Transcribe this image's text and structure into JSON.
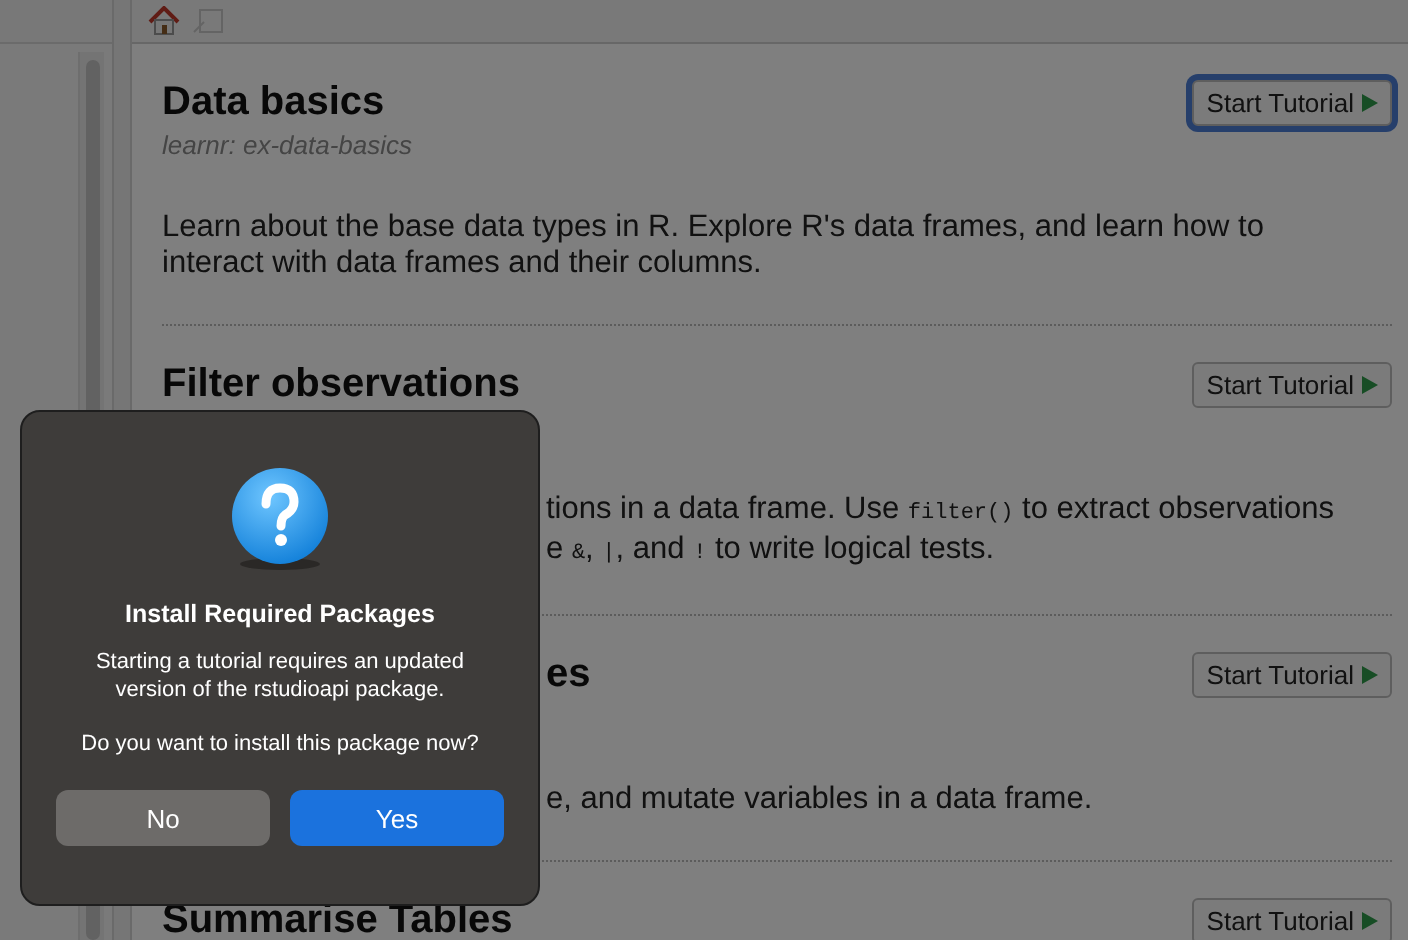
{
  "tutorials": [
    {
      "title": "Data basics",
      "title_clipped": false,
      "subtitle": "learnr: ex-data-basics",
      "description_clipped": false,
      "description": [
        [
          {
            "kind": "text",
            "text": "Learn about the base data types in R. Explore R's data frames, and learn how to"
          }
        ],
        [
          {
            "kind": "text",
            "text": "interact with data frames and their columns."
          }
        ]
      ],
      "button": "Start Tutorial",
      "focused": true
    },
    {
      "title": "Filter observations",
      "title_clipped": false,
      "description_clipped": true,
      "description": [
        [
          {
            "kind": "text",
            "text": "tions in a data frame. Use "
          },
          {
            "kind": "code",
            "text": "filter()"
          },
          {
            "kind": "text",
            "text": " to extract observations"
          }
        ],
        [
          {
            "kind": "text",
            "text": "e "
          },
          {
            "kind": "code",
            "text": "&"
          },
          {
            "kind": "text",
            "text": ", "
          },
          {
            "kind": "code",
            "text": "|"
          },
          {
            "kind": "text",
            "text": ", and "
          },
          {
            "kind": "code",
            "text": "!"
          },
          {
            "kind": "text",
            "text": " to write logical tests."
          }
        ]
      ],
      "button": "Start Tutorial",
      "focused": false
    },
    {
      "title": "es",
      "title_clipped": true,
      "description_clipped": true,
      "description": [
        [
          {
            "kind": "text",
            "text": "e, and mutate variables in a data frame."
          }
        ]
      ],
      "button": "Start Tutorial",
      "focused": false
    },
    {
      "title": "Summarise Tables",
      "title_clipped": false,
      "button": "Start Tutorial",
      "focused": false
    }
  ],
  "dialog": {
    "title": "Install Required Packages",
    "message": [
      "Starting a tutorial requires an updated",
      "version of the rstudioapi package."
    ],
    "question": "Do you want to install this package now?",
    "buttons": [
      {
        "label": "No",
        "kind": "secondary"
      },
      {
        "label": "Yes",
        "kind": "primary"
      }
    ]
  }
}
